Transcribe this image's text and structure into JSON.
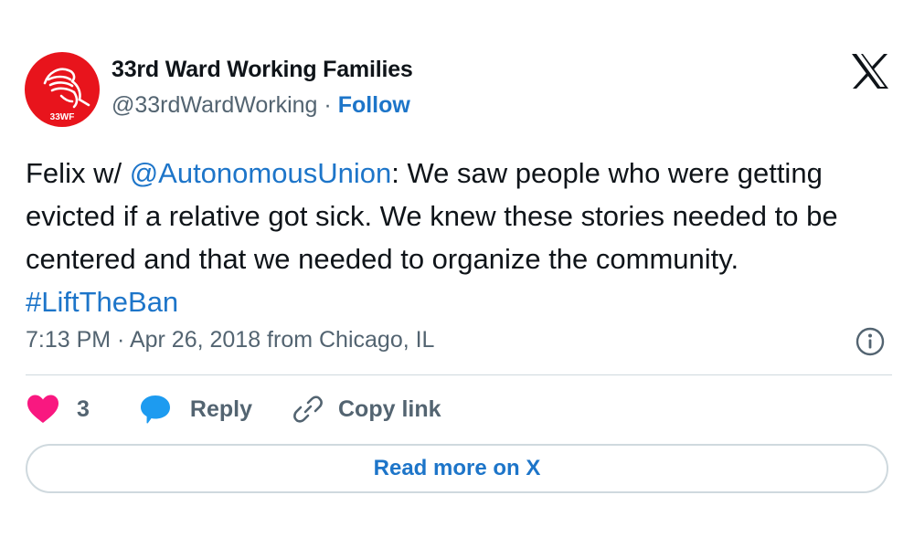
{
  "account": {
    "display_name": "33rd Ward Working Families",
    "handle": "@33rdWardWorking",
    "separator": "·",
    "follow_label": "Follow",
    "avatar_text": "33WF",
    "avatar_color": "#e8141c",
    "avatar_icon": "handshake-icon"
  },
  "tweet": {
    "text_prefix": "Felix w/ ",
    "mention": "@AutonomousUnion",
    "text_body": ": We saw people who were getting evicted if a relative got sick. We knew these stories needed to be centered and that we needed to organize the community. ",
    "hashtag": "#LiftTheBan",
    "timestamp": "7:13 PM · Apr 26, 2018 from Chicago, IL"
  },
  "actions": {
    "like_count": "3",
    "reply_label": "Reply",
    "copy_link_label": "Copy link"
  },
  "footer": {
    "read_more_label": "Read more on X"
  },
  "colors": {
    "link": "#1d75c9",
    "like": "#f91880",
    "reply": "#1d9bf0",
    "text": "#0f1419",
    "muted": "#536471"
  }
}
